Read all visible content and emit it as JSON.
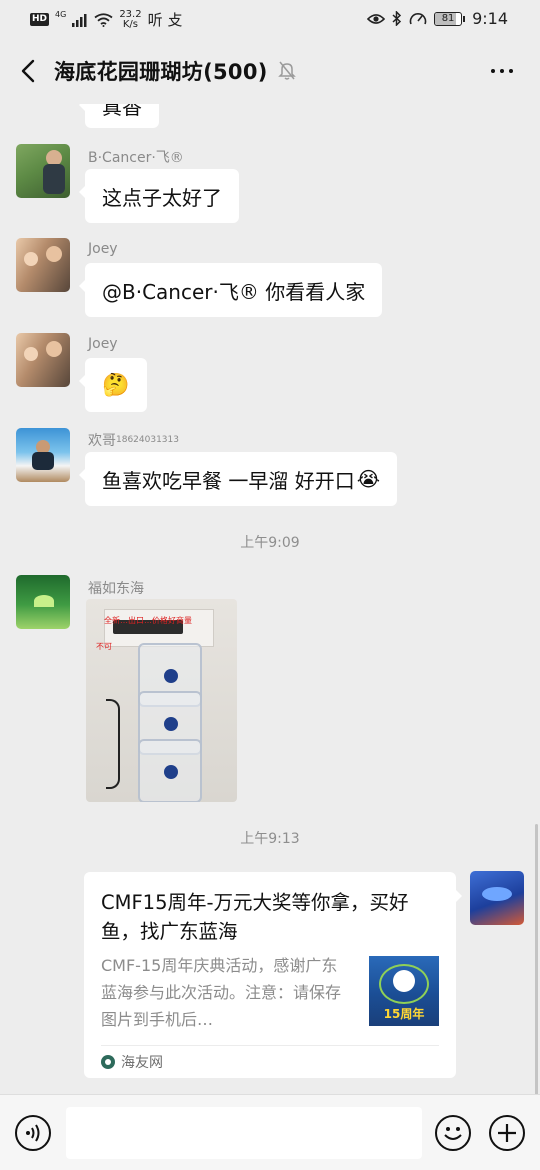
{
  "status_bar": {
    "hd": "HD",
    "network": "4G",
    "speed_value": "23.2",
    "speed_unit": "K/s",
    "app_label": "听 攴",
    "battery_level": "81",
    "battery_fraction": 0.81,
    "time": "9:14"
  },
  "header": {
    "title": "海底花园珊瑚坊(500)",
    "muted": true
  },
  "messages": [
    {
      "type": "text",
      "sender": "",
      "text": "真香",
      "partial": true
    },
    {
      "type": "text",
      "sender": "B·Cancer·飞®",
      "text": "这点子太好了"
    },
    {
      "type": "text",
      "sender": "Joey",
      "text": "@B·Cancer·飞®  你看看人家"
    },
    {
      "type": "emoji",
      "sender": "Joey",
      "text": "🤔"
    },
    {
      "type": "text",
      "sender_name": "欢哥",
      "sender_suffix": "18624031313",
      "text": "鱼喜欢吃早餐  一早溜 好开口",
      "emoji": "😭"
    },
    {
      "type": "time",
      "text": "上午9:09"
    },
    {
      "type": "image",
      "sender": "福如东海",
      "overlay_text_1": "全新…出口…价格好商量",
      "overlay_text_2": "不可"
    },
    {
      "type": "time",
      "text": "上午9:13"
    },
    {
      "type": "link",
      "self": true,
      "title": "CMF15周年-万元大奖等你拿，买好鱼，找广东蓝海",
      "description": "CMF-15周年庆典活动，感谢广东蓝海参与此次活动。注意：请保存图片到手机后…",
      "thumb_text": "15周年",
      "source": "海友网"
    }
  ],
  "input_bar": {
    "placeholder": ""
  },
  "colors": {
    "background": "#ededed",
    "bubble": "#ffffff",
    "meta_text": "#8e8e8e"
  }
}
